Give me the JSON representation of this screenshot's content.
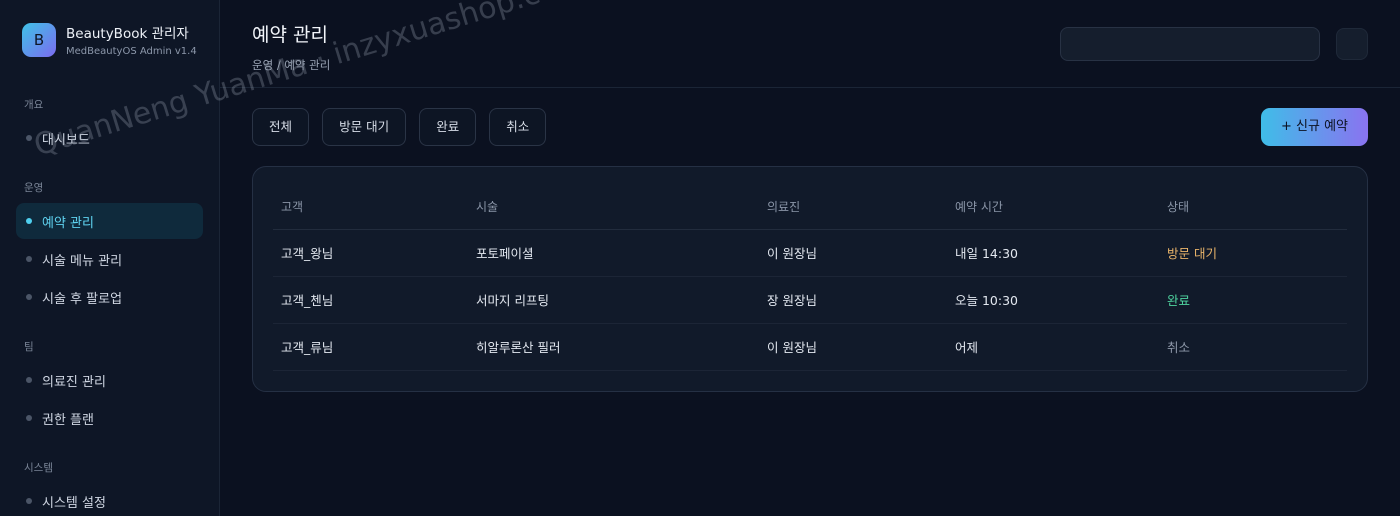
{
  "brand": {
    "logo_letter": "B",
    "title": "BeautyBook 관리자",
    "subtitle": "MedBeautyOS Admin v1.4"
  },
  "sidebar": {
    "groups": [
      {
        "label": "개요",
        "items": [
          {
            "label": "대시보드"
          }
        ]
      },
      {
        "label": "운영",
        "items": [
          {
            "label": "예약 관리",
            "active": true
          },
          {
            "label": "시술 메뉴 관리"
          },
          {
            "label": "시술 후 팔로업"
          }
        ]
      },
      {
        "label": "팀",
        "items": [
          {
            "label": "의료진 관리"
          },
          {
            "label": "권한 플랜"
          }
        ]
      },
      {
        "label": "시스템",
        "items": [
          {
            "label": "시스템 설정"
          }
        ]
      }
    ]
  },
  "header": {
    "title": "예약 관리",
    "breadcrumb": "운영 / 예약 관리",
    "search_value": ""
  },
  "filters": [
    "전체",
    "방문 대기",
    "완료",
    "취소"
  ],
  "new_button_label": "+ 신규 예약",
  "table": {
    "columns": [
      "고객",
      "시술",
      "의료진",
      "예약 시간",
      "상태"
    ],
    "rows": [
      [
        "고객_왕님",
        "포토페이셜",
        "이 원장님",
        "내일 14:30",
        "방문 대기"
      ],
      [
        "고객_첸님",
        "서마지 리프팅",
        "장 원장님",
        "오늘 10:30",
        "완료"
      ],
      [
        "고객_류님",
        "히알루론산 필러",
        "이 원장님",
        "어제",
        "취소"
      ]
    ]
  },
  "colors": {
    "accent": "#4fd0ef",
    "status_wait": "#e9b46a",
    "status_done": "#4fd6a0",
    "status_cancel": "#8f99aa"
  },
  "watermark": "QuanNeng YuanMa · inzyxuashop.com"
}
